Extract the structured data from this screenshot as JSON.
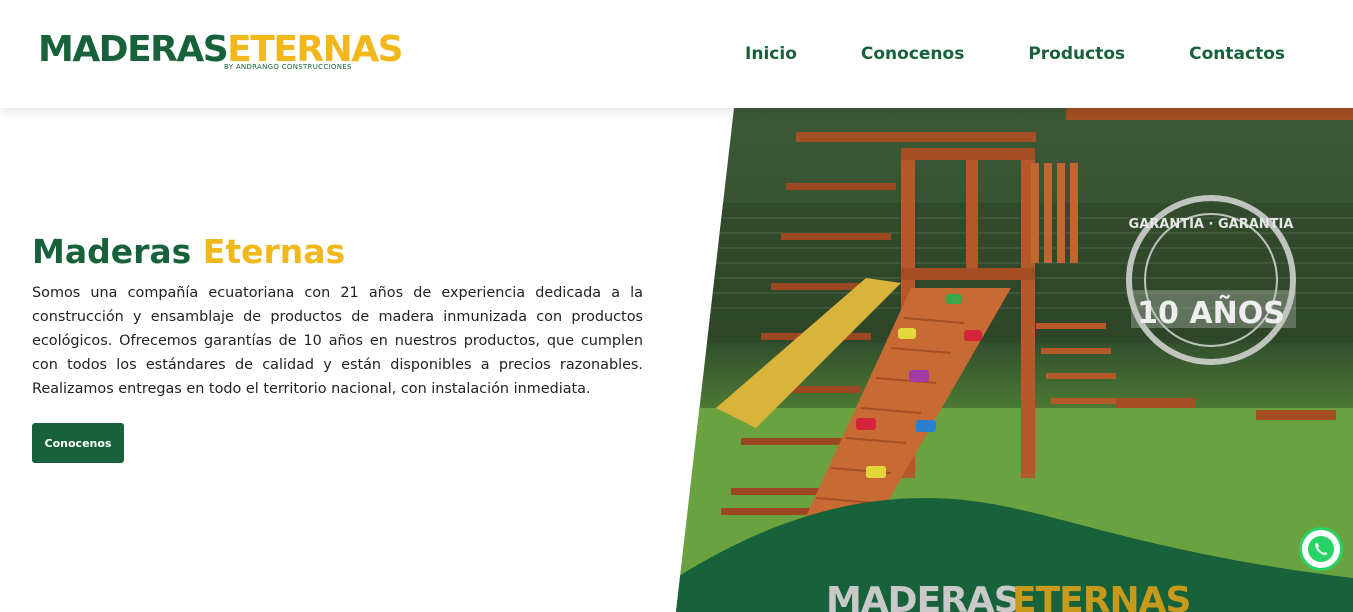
{
  "brand": {
    "logo_part1": "MADERAS",
    "logo_part2": "ETERNAS",
    "logo_tagline": "BY ANDRANGO CONSTRUCCIONES"
  },
  "nav": {
    "items": [
      {
        "label": "Inicio"
      },
      {
        "label": "Conocenos"
      },
      {
        "label": "Productos"
      },
      {
        "label": "Contactos"
      }
    ]
  },
  "hero": {
    "title_part1": "Maderas ",
    "title_part2": "Eternas",
    "description": "Somos una compañía ecuatoriana con 21 años de experiencia dedicada a la construcción y ensamblaje de productos de madera inmunizada con productos ecológicos. Ofrecemos garantías de 10 años en nuestros productos, que cumplen con todos los estándares de calidad y están disponibles a precios razonables. Realizamos entregas en todo el territorio nacional, con instalación inmediata.",
    "button_label": "Conocenos"
  },
  "hero_image": {
    "badge_ring_text": "GARANTIA · GARANTIA",
    "badge_main_text": "10 AÑOS",
    "footer_logo_part1": "MADERAS",
    "footer_logo_part2": "ETERNAS"
  },
  "colors": {
    "brand_green": "#17623a",
    "brand_yellow": "#f2b71b",
    "wood": "#b5582a"
  },
  "floating": {
    "whatsapp_icon": "whatsapp-icon"
  }
}
